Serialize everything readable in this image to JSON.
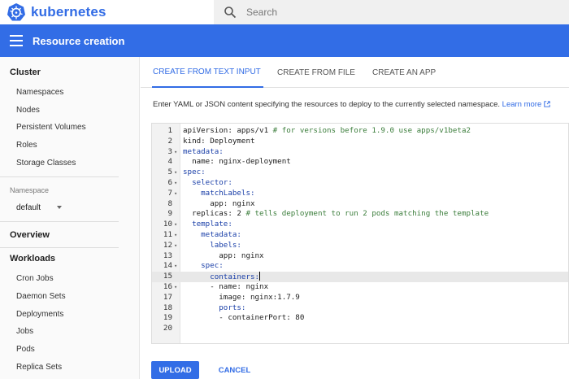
{
  "app": {
    "brand": "kubernetes",
    "logo_icon": "kubernetes-wheel-icon",
    "brand_color": "#326ce5",
    "header_color": "#326de6"
  },
  "search": {
    "placeholder": "Search",
    "icon": "search-icon"
  },
  "header": {
    "title": "Resource creation",
    "menu_icon": "hamburger-menu-icon"
  },
  "sidebar": {
    "cluster": {
      "title": "Cluster",
      "items": [
        "Namespaces",
        "Nodes",
        "Persistent Volumes",
        "Roles",
        "Storage Classes"
      ]
    },
    "namespace": {
      "label": "Namespace",
      "selected": "default"
    },
    "overview": "Overview",
    "workloads": {
      "title": "Workloads",
      "items": [
        "Cron Jobs",
        "Daemon Sets",
        "Deployments",
        "Jobs",
        "Pods",
        "Replica Sets"
      ]
    }
  },
  "tabs": [
    {
      "label": "CREATE FROM TEXT INPUT",
      "active": true
    },
    {
      "label": "CREATE FROM FILE",
      "active": false
    },
    {
      "label": "CREATE AN APP",
      "active": false
    }
  ],
  "description": {
    "text": "Enter YAML or JSON content specifying the resources to deploy to the currently selected namespace.",
    "link": "Learn more",
    "link_icon": "external-link-icon"
  },
  "editor": {
    "active_line": 15,
    "lines": [
      {
        "n": "1",
        "fold": false,
        "code": "apiVersion: apps/v1 # for versions before 1.9.0 use apps/v1beta2"
      },
      {
        "n": "2",
        "fold": false,
        "code": "kind: Deployment"
      },
      {
        "n": "3",
        "fold": true,
        "code": "metadata:"
      },
      {
        "n": "4",
        "fold": false,
        "code": "  name: nginx-deployment"
      },
      {
        "n": "5",
        "fold": true,
        "code": "spec:"
      },
      {
        "n": "6",
        "fold": true,
        "code": "  selector:"
      },
      {
        "n": "7",
        "fold": true,
        "code": "    matchLabels:"
      },
      {
        "n": "8",
        "fold": false,
        "code": "      app: nginx"
      },
      {
        "n": "9",
        "fold": false,
        "code": "  replicas: 2 # tells deployment to run 2 pods matching the template"
      },
      {
        "n": "10",
        "fold": true,
        "code": "  template:"
      },
      {
        "n": "11",
        "fold": true,
        "code": "    metadata:"
      },
      {
        "n": "12",
        "fold": true,
        "code": "      labels:"
      },
      {
        "n": "13",
        "fold": false,
        "code": "        app: nginx"
      },
      {
        "n": "14",
        "fold": true,
        "code": "    spec:"
      },
      {
        "n": "15",
        "fold": false,
        "code": "      containers:"
      },
      {
        "n": "16",
        "fold": true,
        "code": "      - name: nginx"
      },
      {
        "n": "17",
        "fold": false,
        "code": "        image: nginx:1.7.9"
      },
      {
        "n": "18",
        "fold": false,
        "code": "        ports:"
      },
      {
        "n": "19",
        "fold": false,
        "code": "        - containerPort: 80"
      },
      {
        "n": "20",
        "fold": false,
        "code": ""
      }
    ]
  },
  "actions": {
    "upload": "UPLOAD",
    "cancel": "CANCEL"
  }
}
